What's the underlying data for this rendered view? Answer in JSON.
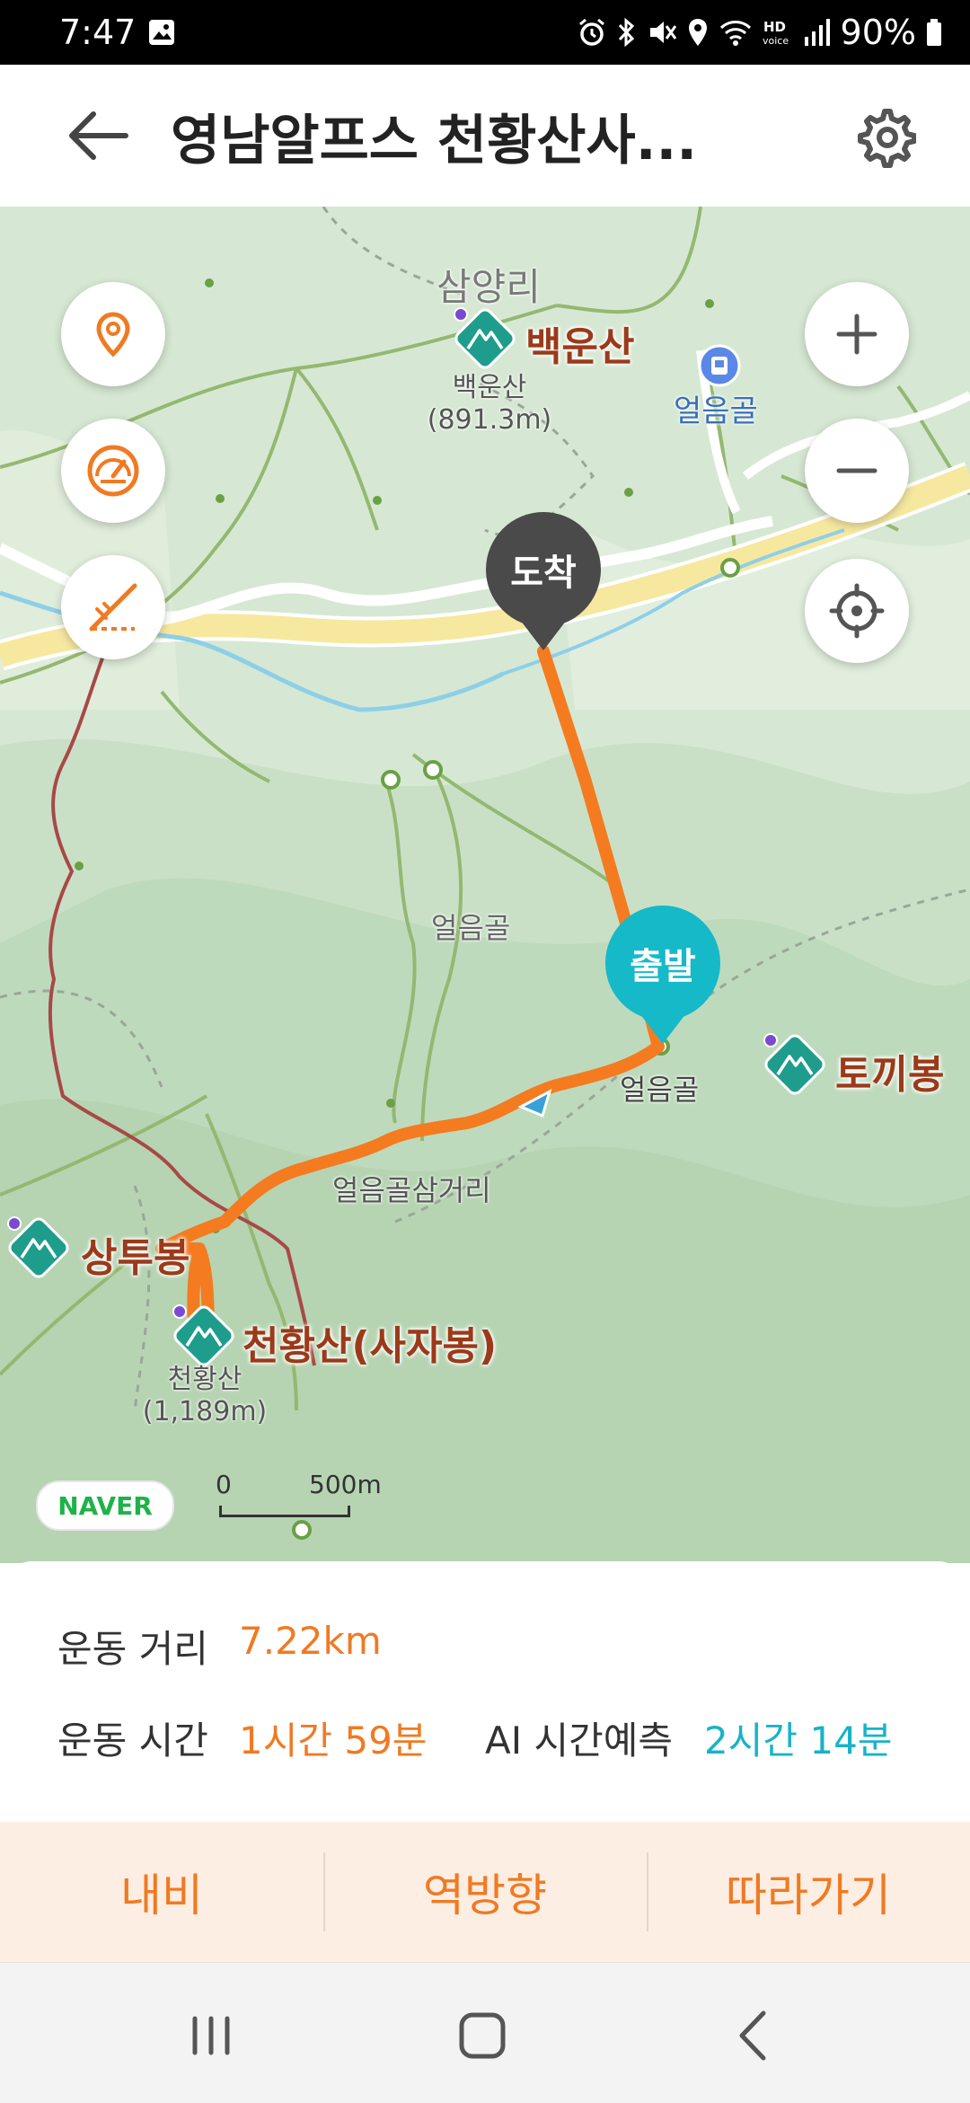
{
  "status_bar": {
    "time": "7:47",
    "battery": "90%",
    "icons": [
      "gallery-icon",
      "alarm-icon",
      "bluetooth-icon",
      "mute-icon",
      "location-icon",
      "wifi-icon",
      "hd-voice-icon",
      "signal-icon",
      "battery-icon"
    ]
  },
  "header": {
    "title": "영남알프스 천황산사...",
    "back_icon": "arrow-left-icon",
    "settings_icon": "gear-icon"
  },
  "map": {
    "place_labels": {
      "samyangri": "삼양리",
      "baekunsan": "백운산",
      "baekunsan_sub": "백운산\n(891.3m)",
      "eoleumgol_ne": "얼음골",
      "eoleumgol_mid": "얼음골",
      "eoleumgol_start": "얼음골",
      "tokkibong": "토끼봉",
      "eoleumgol_samgeori": "얼음골삼거리",
      "sangtubong": "상투봉",
      "cheonhwangsan": "천황산(사자봉)",
      "cheonhwangsan_sub": "천황산\n(1,189m)"
    },
    "markers": {
      "arrive": "도착",
      "start": "출발"
    },
    "controls": {
      "location_pin_icon": "location-pin-icon",
      "speedometer_icon": "speedometer-icon",
      "slope_icon": "slope-icon",
      "zoom_in_icon": "plus-icon",
      "zoom_out_icon": "minus-icon",
      "my_location_icon": "crosshair-icon"
    },
    "provider_logo": "NAVER",
    "scale": {
      "zero": "0",
      "distance": "500m"
    },
    "colors": {
      "route": "#f47b20",
      "arrive_marker": "#4a4a4a",
      "start_marker": "#16b9c8"
    }
  },
  "summary": {
    "distance_label": "운동 거리",
    "distance_value": "7.22km",
    "time_label": "운동 시간",
    "time_value": "1시간 59분",
    "ai_label": "AI 시간예측",
    "ai_value": "2시간 14분"
  },
  "actions": {
    "navigate": "내비",
    "reverse": "역방향",
    "follow": "따라가기"
  },
  "navbar": {
    "recents_icon": "recents-icon",
    "home_icon": "home-icon",
    "back_icon": "back-chevron-icon"
  }
}
